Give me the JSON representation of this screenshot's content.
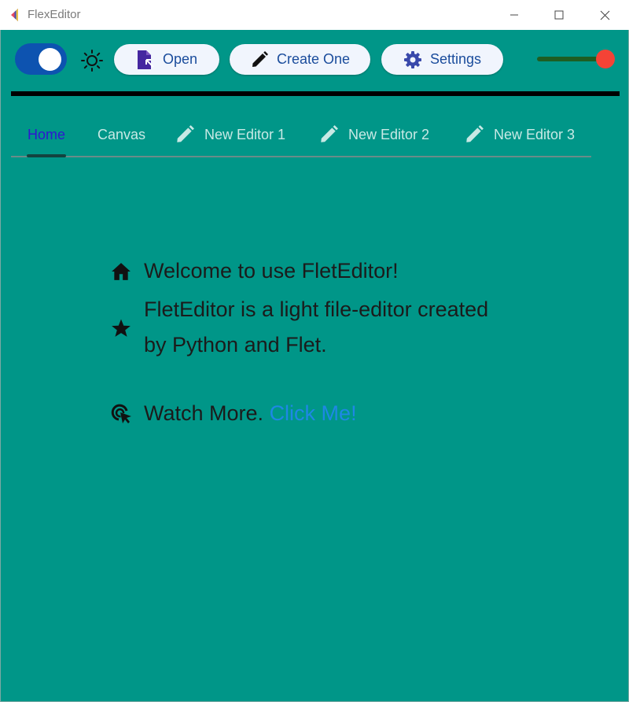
{
  "window": {
    "title": "FlexEditor"
  },
  "toolbar": {
    "open_label": "Open",
    "create_label": "Create One",
    "settings_label": "Settings",
    "theme_switch_on": true,
    "slider_value": 0.9
  },
  "tabs": [
    {
      "label": "Home",
      "selected": true
    },
    {
      "label": "Canvas"
    },
    {
      "label": "New Editor 1",
      "icon": "pencil-icon"
    },
    {
      "label": "New Editor 2",
      "icon": "pencil-icon"
    },
    {
      "label": "New Editor 3",
      "icon": "pencil-icon"
    }
  ],
  "home": {
    "welcome": "Welcome to use FletEditor!",
    "description_line1": "FletEditor is a light file-editor created",
    "description_line2": "by Python and Flet.",
    "watch_more": "Watch More.",
    "link_text": "Click Me!"
  },
  "colors": {
    "background": "#009688",
    "switch": "#0d53b0",
    "slider_thumb": "#f44336",
    "selected_tab": "#2f16d0",
    "link": "#1e88e5"
  }
}
